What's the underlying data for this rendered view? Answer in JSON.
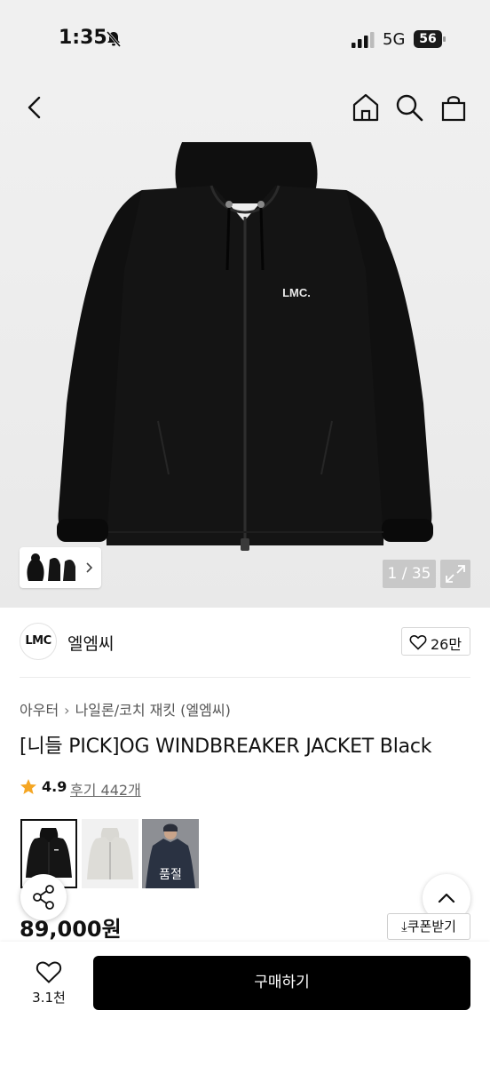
{
  "status_bar": {
    "time": "1:35",
    "network": "5G",
    "battery": "56"
  },
  "gallery": {
    "page_counter": "1 / 35",
    "jacket_logo": "LMC."
  },
  "brand": {
    "logo_text": "LMC",
    "name": "엘엠씨",
    "likes": "26만"
  },
  "breadcrumb": [
    "아우터",
    "나일론/코치 재킷 (엘엠씨)"
  ],
  "product": {
    "title": "[니들 PICK]OG WINDBREAKER JACKET Black",
    "rating": "4.9",
    "reviews": "후기 442개",
    "price": "89,000원"
  },
  "options": [
    {
      "color": "Black",
      "selected": true
    },
    {
      "color": "Light Gray",
      "selected": false
    },
    {
      "color": "Navy",
      "selected": false,
      "status": "품절"
    }
  ],
  "coupon_label": "쿠폰받기",
  "bottom_bar": {
    "wish_count": "3.1천",
    "buy_label": "구매하기"
  },
  "colors": {
    "accent": "#000000",
    "star": "#f5a623",
    "background": "#f0f0f0"
  }
}
